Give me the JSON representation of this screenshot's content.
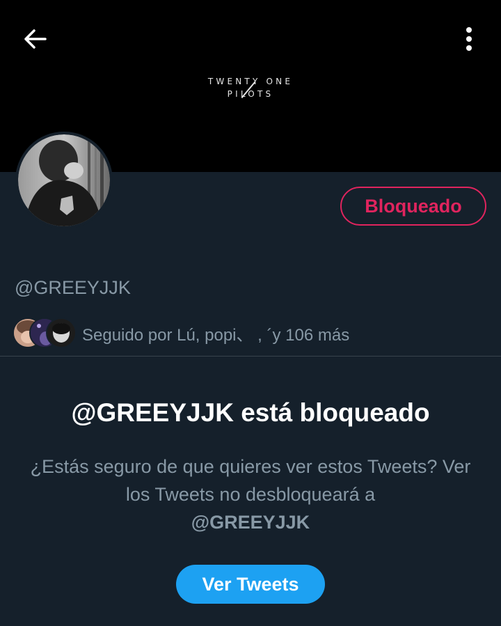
{
  "header": {
    "back_icon": "arrow-left-icon",
    "more_icon": "more-vertical-icon"
  },
  "banner": {
    "logo_line1": "TWENTY ONE",
    "logo_line2": "PILOTS"
  },
  "profile": {
    "handle": "@GREEYJJK",
    "blocked_label": "Bloqueado",
    "followed_by": "Seguido por Lú, popi、 , ´y 106 más"
  },
  "blocked_notice": {
    "title": "@GREEYJJK está bloqueado",
    "description": "¿Estás seguro de que quieres ver estos Tweets? Ver los Tweets no desbloqueará a",
    "handle": "@GREEYJJK",
    "view_button": "Ver Tweets"
  },
  "colors": {
    "background": "#15202b",
    "banner": "#000000",
    "blocked_red": "#e0245e",
    "accent_blue": "#1da1f2",
    "muted_text": "#8899a6"
  }
}
